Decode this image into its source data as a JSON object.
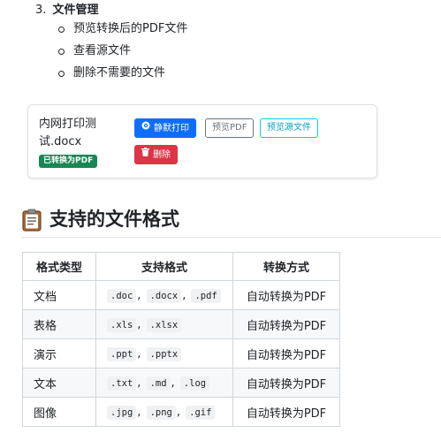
{
  "section": {
    "number": "3.",
    "title": "文件管理",
    "bullets": [
      "预览转换后的PDF文件",
      "查看源文件",
      "删除不需要的文件"
    ]
  },
  "file_card": {
    "file_name": "内网打印测试.docx",
    "badge": "已转换为PDF",
    "buttons": {
      "silent_print": "静默打印",
      "preview_pdf": "预览PDF",
      "preview_source": "预览源文件",
      "delete": "删除"
    }
  },
  "heading": {
    "icon": "clipboard-icon",
    "text": "支持的文件格式"
  },
  "table": {
    "headers": [
      "格式类型",
      "支持格式",
      "转换方式"
    ],
    "rows": [
      {
        "type": "文档",
        "formats": [
          ".doc",
          ".docx",
          ".pdf"
        ],
        "method": "自动转换为PDF"
      },
      {
        "type": "表格",
        "formats": [
          ".xls",
          ".xlsx"
        ],
        "method": "自动转换为PDF"
      },
      {
        "type": "演示",
        "formats": [
          ".ppt",
          ".pptx"
        ],
        "method": "自动转换为PDF"
      },
      {
        "type": "文本",
        "formats": [
          ".txt",
          ".md",
          ".log"
        ],
        "method": "自动转换为PDF"
      },
      {
        "type": "图像",
        "formats": [
          ".jpg",
          ".png",
          ".gif"
        ],
        "method": "自动转换为PDF"
      }
    ]
  },
  "colors": {
    "primary": "#0d6efd",
    "success": "#198754",
    "danger": "#dc3545",
    "info": "#0dcaf0",
    "secondary": "#6c757d"
  }
}
